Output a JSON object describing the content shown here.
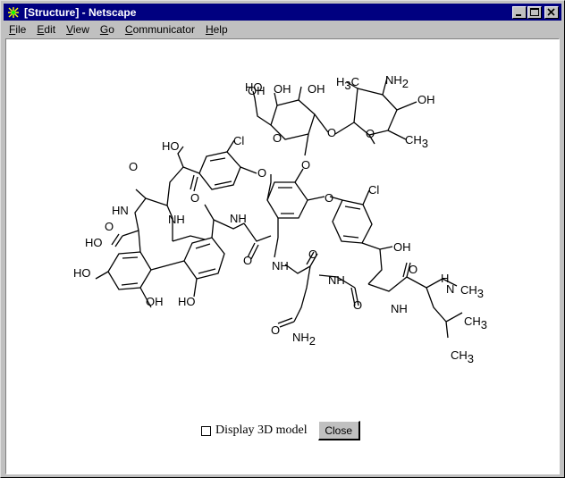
{
  "window": {
    "title": "[Structure] - Netscape",
    "app_icon": "netscape-icon",
    "controls": [
      "minimize-icon",
      "maximize-icon",
      "close-icon"
    ]
  },
  "menubar": {
    "items": [
      {
        "label": "File",
        "mnemonic": "F",
        "rest": "ile"
      },
      {
        "label": "Edit",
        "mnemonic": "E",
        "rest": "dit"
      },
      {
        "label": "View",
        "mnemonic": "V",
        "rest": "iew"
      },
      {
        "label": "Go",
        "mnemonic": "G",
        "rest": "o"
      },
      {
        "label": "Communicator",
        "mnemonic": "C",
        "rest": "ommunicator"
      },
      {
        "label": "Help",
        "mnemonic": "H",
        "rest": "elp"
      }
    ]
  },
  "structure": {
    "labels": {
      "oh_1": "OH",
      "oh_2": "OH",
      "ho_1": "HO",
      "nh2_top": "NH",
      "nh2_top_sub": "2",
      "h3c": "H",
      "h3c_sub": "3",
      "h3c_c": "C",
      "ch3_1": "CH",
      "ch3_1_sub": "3",
      "oh_3": "OH",
      "cl_1": "Cl",
      "cl_2": "Cl",
      "ho_2": "HO",
      "o_1": "O",
      "o_2": "O",
      "o_3": "O",
      "o_4": "O",
      "o_5": "O",
      "o_6": "O",
      "nh_1": "NH",
      "nh_2": "NH",
      "hn_1": "HN",
      "nh_3": "NH",
      "nh_4": "NH",
      "nh_5": "NH",
      "nh_6": "N",
      "h_me": "H",
      "ch3_2": "CH",
      "ch3_2_sub": "3",
      "ho_3": "HO",
      "ho_4": "HO",
      "oh_4": "OH",
      "ho_5": "HO",
      "oh_5": "OH",
      "nh2_bottom": "NH",
      "nh2_bottom_sub": "2",
      "ch3_3": "CH",
      "ch3_3_sub": "3",
      "ch3_4": "CH",
      "ch3_4_sub": "3",
      "o_7": "O",
      "o_8": "O",
      "o_9": "O",
      "o_10": "O",
      "o_11": "O",
      "o_12": "O",
      "o_13": "O",
      "o_14": "O"
    }
  },
  "controls": {
    "checkbox_label": "Display 3D model",
    "checkbox_checked": false,
    "close_label": "Close"
  }
}
